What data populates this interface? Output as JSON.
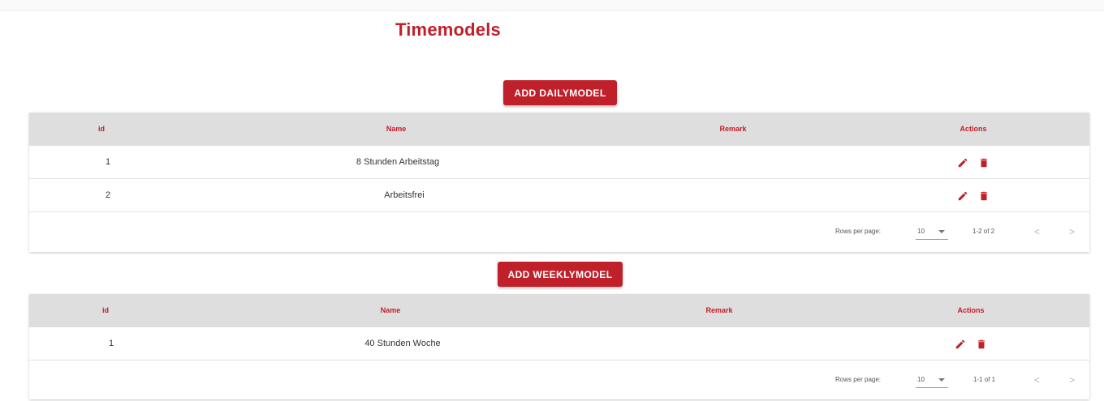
{
  "page": {
    "title": "Timemodels"
  },
  "colors": {
    "accent": "#c0202a",
    "header_bg": "#dedede"
  },
  "icons": {
    "edit": "pencil-icon",
    "delete": "trash-icon",
    "prev": "chevron-left-icon",
    "next": "chevron-right-icon",
    "dropdown": "caret-down-icon"
  },
  "daily": {
    "add_label": "ADD DAILYMODEL",
    "columns": {
      "id": "id",
      "name": "Name",
      "remark": "Remark",
      "actions": "Actions"
    },
    "rows": [
      {
        "id": "1",
        "name": "8 Stunden Arbeitstag",
        "remark": ""
      },
      {
        "id": "2",
        "name": "Arbeitsfrei",
        "remark": ""
      }
    ],
    "pagination": {
      "rows_per_page_label": "Rows per page:",
      "rows_per_page": "10",
      "range": "1-2 of 2",
      "prev": "<",
      "next": ">"
    }
  },
  "weekly": {
    "add_label": "ADD WEEKLYMODEL",
    "columns": {
      "id": "id",
      "name": "Name",
      "remark": "Remark",
      "actions": "Actions"
    },
    "rows": [
      {
        "id": "1",
        "name": "40 Stunden Woche",
        "remark": ""
      }
    ],
    "pagination": {
      "rows_per_page_label": "Rows per page:",
      "rows_per_page": "10",
      "range": "1-1 of 1",
      "prev": "<",
      "next": ">"
    }
  }
}
